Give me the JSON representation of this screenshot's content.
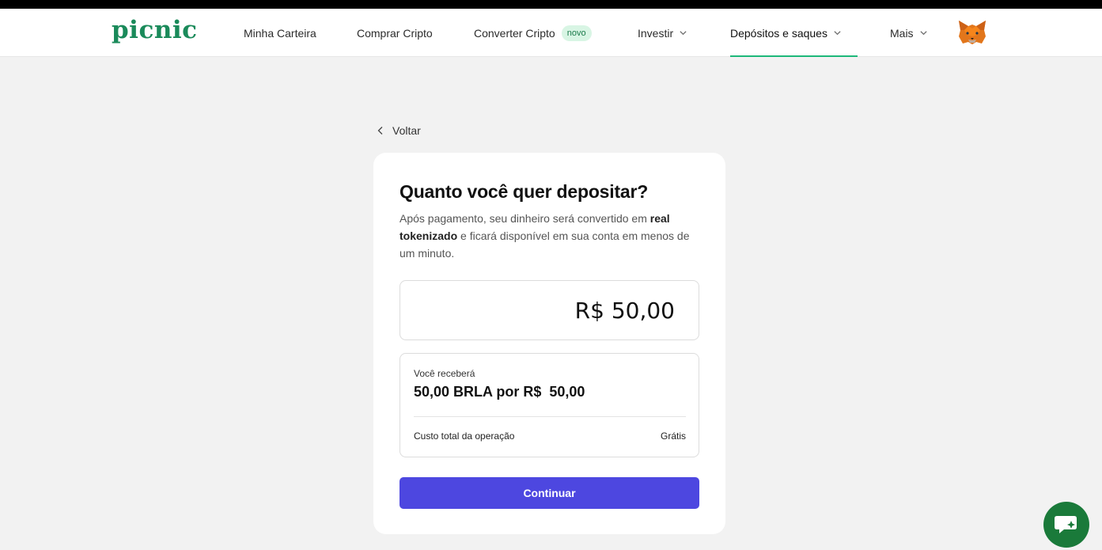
{
  "header": {
    "logo": "picnic",
    "nav": [
      {
        "label": "Minha Carteira"
      },
      {
        "label": "Comprar Cripto"
      },
      {
        "label": "Converter Cripto",
        "badge": "novo"
      },
      {
        "label": "Investir"
      },
      {
        "label": "Depósitos e saques",
        "active": true
      },
      {
        "label": "Mais"
      }
    ],
    "avatar_icon": "metamask-fox-icon"
  },
  "back": {
    "label": "Voltar"
  },
  "deposit": {
    "title": "Quanto você quer depositar?",
    "desc_part1": "Após pagamento, seu dinheiro será convertido em ",
    "desc_bold1": "real tokenizado",
    "desc_part2": " e ficará disponível em sua conta em menos de um minuto.",
    "amount": "R$ 50,00",
    "receive_label": "Você receberá",
    "receive_value": "50,00 BRLA por R$  50,00",
    "cost_label": "Custo total da operação",
    "cost_value": "Grátis",
    "continue_label": "Continuar"
  },
  "colors": {
    "brand_green": "#1a8a5a",
    "active_underline": "#1db87a",
    "primary_button": "#4d47e0",
    "chat_button": "#1a7a3a",
    "page_bg": "#f2f2f2"
  }
}
